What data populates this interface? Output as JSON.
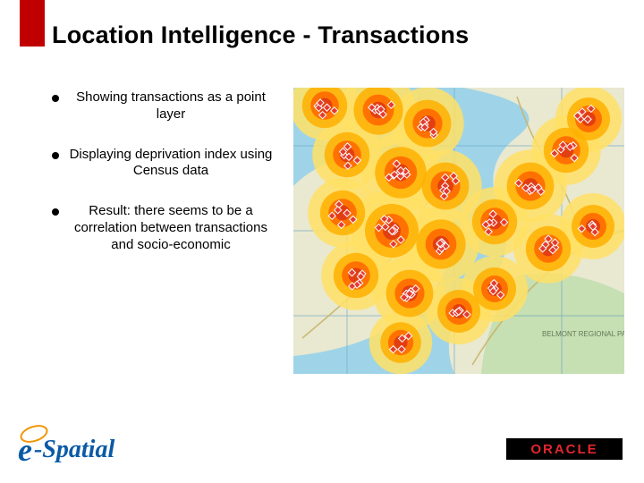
{
  "title": "Location Intelligence - Transactions",
  "bullets": [
    "Showing transactions as a point layer",
    "Displaying deprivation index using Census data",
    "Result: there seems to be a correlation between transactions and socio-economic"
  ],
  "logos": {
    "espatial_e": "e",
    "espatial_rest": "-Spatial",
    "oracle": "ORACLE"
  },
  "map": {
    "label_park": "BELMONT REGIONAL PARK",
    "colors": {
      "water": "#9fd4e8",
      "land_low": "#e9e8d0",
      "forest": "#c6dfb3",
      "heat1": "#ffe066",
      "heat2": "#ffb000",
      "heat3": "#ff6a00",
      "heat4": "#e23b12",
      "road": "#c7b46a",
      "grid": "#6fa6c4",
      "point_fill": "#e43b2f",
      "point_stroke": "#ffffff"
    }
  }
}
